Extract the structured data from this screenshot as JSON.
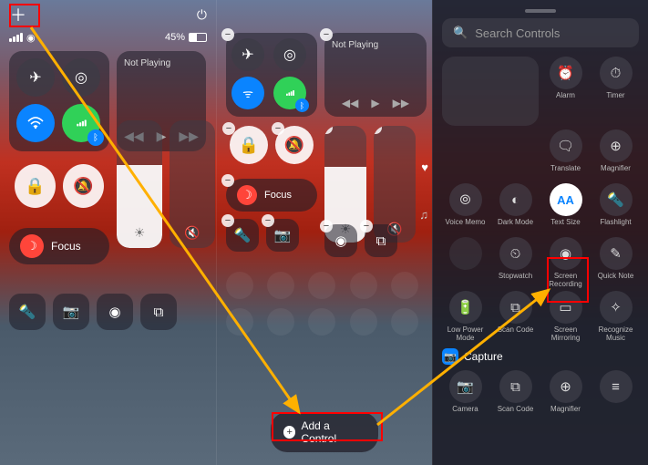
{
  "panel1": {
    "battery_label": "45%",
    "not_playing": "Not Playing",
    "focus_label": "Focus"
  },
  "panel2": {
    "not_playing": "Not Playing",
    "focus_label": "Focus",
    "add_control_label": "Add a Control"
  },
  "panel3": {
    "search_placeholder": "Search Controls",
    "capture_section": "Capture",
    "controls": {
      "alarm": "Alarm",
      "timer": "Timer",
      "translate": "Translate",
      "magnifier": "Magnifier",
      "voice_memo": "Voice Memo",
      "dark_mode": "Dark Mode",
      "text_size": "Text Size",
      "flashlight": "Flashlight",
      "stopwatch": "Stopwatch",
      "screen_recording": "Screen Recording",
      "quick_note": "Quick Note",
      "low_power": "Low Power Mode",
      "scan_code": "Scan Code",
      "screen_mirroring": "Screen Mirroring",
      "recognize_music": "Recognize Music",
      "camera": "Camera",
      "scan_code2": "Scan Code",
      "magnifier2": "Magnifier"
    },
    "text_size_glyph": "AA"
  },
  "colors": {
    "highlight": "#ff0000",
    "arrow": "#ffb000",
    "ios_blue": "#0a84ff",
    "ios_green": "#30d158",
    "ios_red": "#ff453a"
  }
}
